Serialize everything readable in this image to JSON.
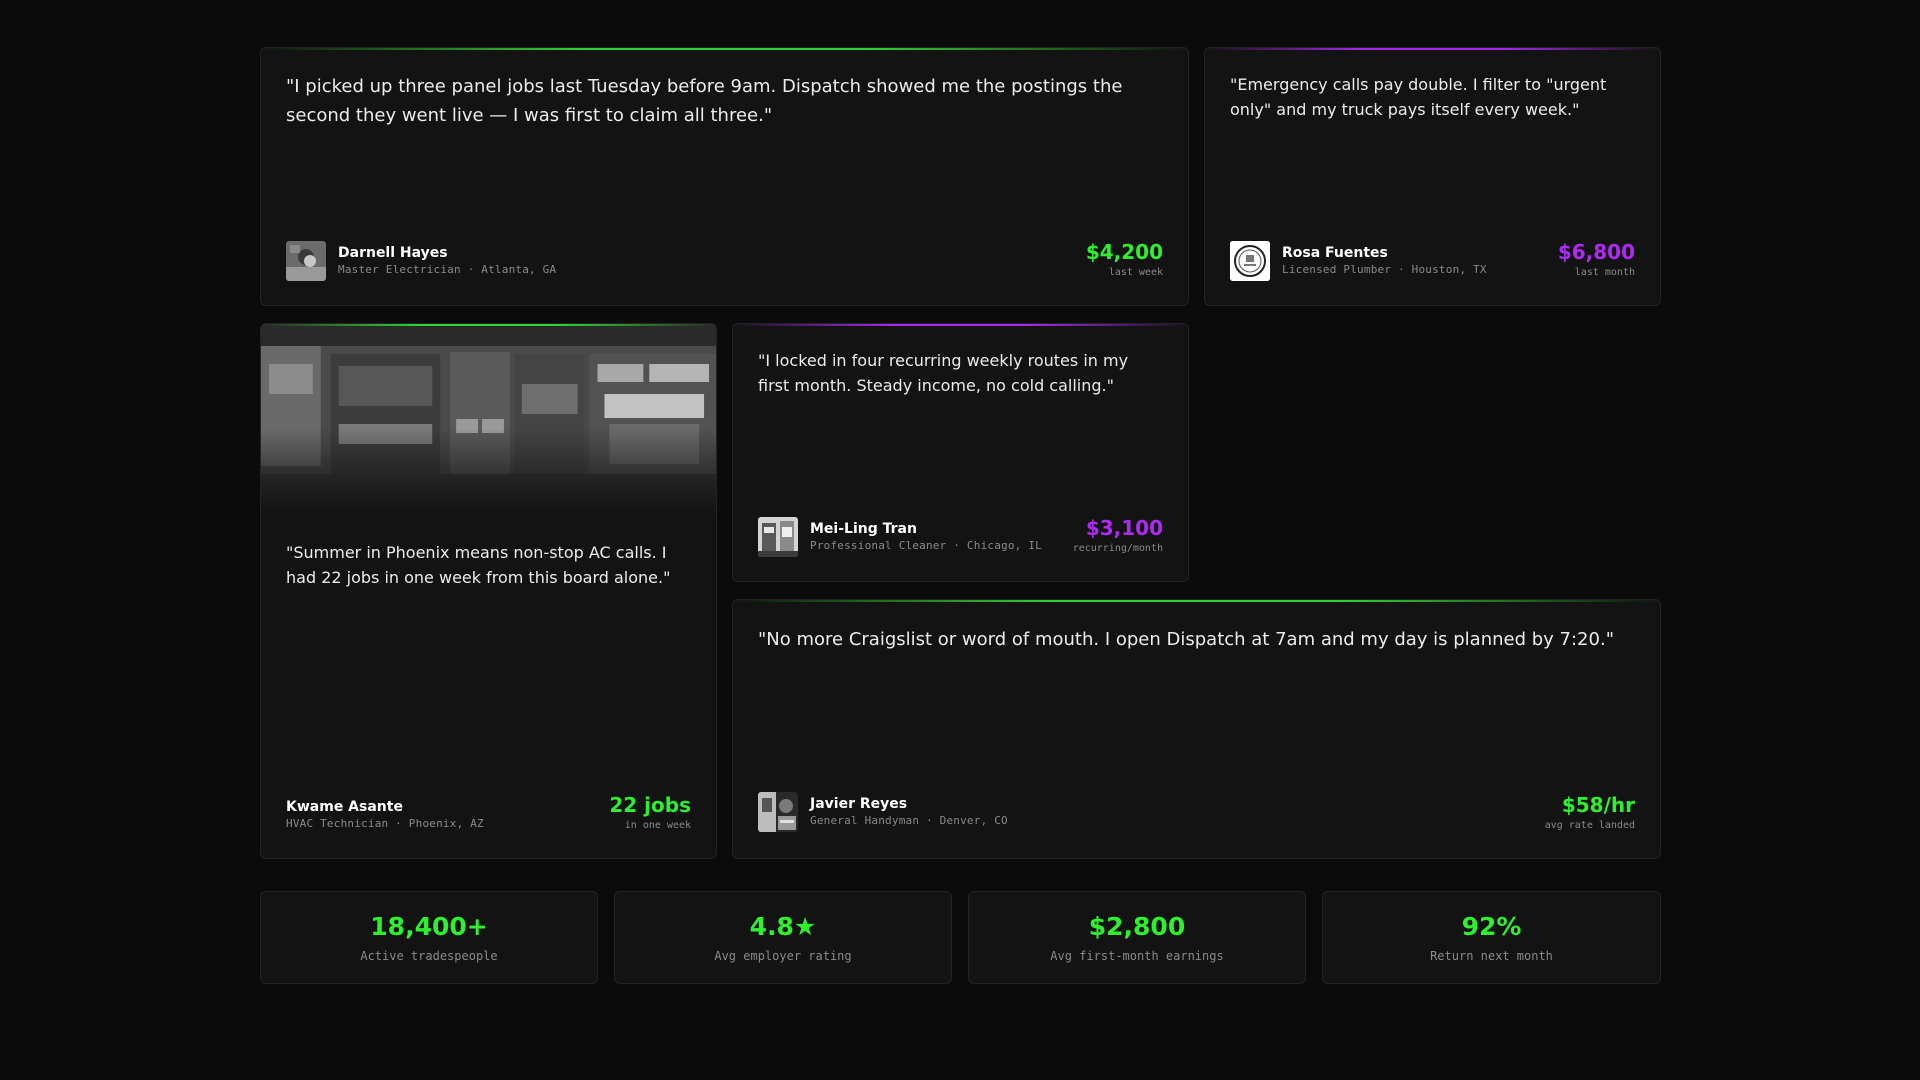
{
  "testimonials": [
    {
      "quote": "\"I picked up three panel jobs last Tuesday before 9am. Dispatch showed me the postings the second they went live — I was first to claim all three.\"",
      "name": "Darnell Hayes",
      "role": "Master Electrician · Atlanta, GA",
      "metric": "$4,200",
      "metric_label": "last week",
      "accent": "green"
    },
    {
      "quote": "\"Emergency calls pay double. I filter to \"urgent only\" and my truck pays itself every week.\"",
      "name": "Rosa Fuentes",
      "role": "Licensed Plumber · Houston, TX",
      "metric": "$6,800",
      "metric_label": "last month",
      "accent": "purple"
    },
    {
      "quote": "\"Summer in Phoenix means non-stop AC calls. I had 22 jobs in one week from this board alone.\"",
      "name": "Kwame Asante",
      "role": "HVAC Technician · Phoenix, AZ",
      "metric": "22 jobs",
      "metric_label": "in one week",
      "accent": "green"
    },
    {
      "quote": "\"I locked in four recurring weekly routes in my first month. Steady income, no cold calling.\"",
      "name": "Mei-Ling Tran",
      "role": "Professional Cleaner · Chicago, IL",
      "metric": "$3,100",
      "metric_label": "recurring/month",
      "accent": "purple"
    },
    {
      "quote": "\"No more Craigslist or word of mouth. I open Dispatch at 7am and my day is planned by 7:20.\"",
      "name": "Javier Reyes",
      "role": "General Handyman · Denver, CO",
      "metric": "$58/hr",
      "metric_label": "avg rate landed",
      "accent": "green"
    }
  ],
  "stats": [
    {
      "value": "18,400+",
      "label": "Active tradespeople"
    },
    {
      "value": "4.8★",
      "label": "Avg employer rating"
    },
    {
      "value": "$2,800",
      "label": "Avg first-month earnings"
    },
    {
      "value": "92%",
      "label": "Return next month"
    }
  ],
  "colors": {
    "background": "#0b0b0b",
    "card": "#131313",
    "accent_green": "#2ff02f",
    "accent_purple": "#b02af5"
  }
}
